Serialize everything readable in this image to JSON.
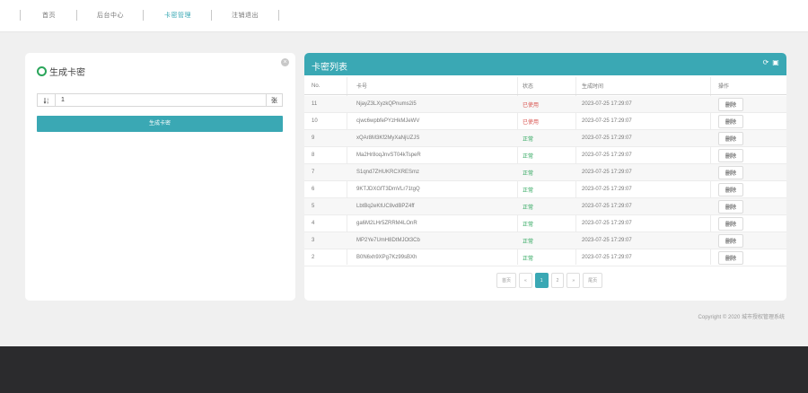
{
  "nav": {
    "items": [
      {
        "label": "首页",
        "active": false
      },
      {
        "label": "后台中心",
        "active": false
      },
      {
        "label": "卡密管理",
        "active": true
      },
      {
        "label": "注销退出",
        "active": false
      }
    ]
  },
  "generate": {
    "title": "生成卡密",
    "prefix_icon": "sort-number-icon",
    "quantity_value": "1",
    "suffix": "张",
    "button_label": "生成卡密",
    "close_icon": "close-icon"
  },
  "list": {
    "title": "卡密列表",
    "icons": [
      "refresh-icon",
      "fullscreen-icon"
    ],
    "columns": {
      "no": "No.",
      "card": "卡号",
      "status": "状态",
      "time": "生成时间",
      "action": "操作"
    },
    "rows": [
      {
        "no": "11",
        "card": "NjayZ3LXyzkQPnums2i5",
        "status": "已使用",
        "used": true,
        "time": "2023-07-25 17:29:07",
        "action": "删除"
      },
      {
        "no": "10",
        "card": "cjwc6wpbfePYzHkMJeWV",
        "status": "已使用",
        "used": true,
        "time": "2023-07-25 17:29:07",
        "action": "删除"
      },
      {
        "no": "9",
        "card": "xQAr8M3Kf2MyXaNjUZJS",
        "status": "正常",
        "used": false,
        "time": "2023-07-25 17:29:07",
        "action": "删除"
      },
      {
        "no": "8",
        "card": "Ma2Hr8oqJnvST04kTspeR",
        "status": "正常",
        "used": false,
        "time": "2023-07-25 17:29:07",
        "action": "删除"
      },
      {
        "no": "7",
        "card": "S1qnd7ZHUKRCXRESmz",
        "status": "正常",
        "used": false,
        "time": "2023-07-25 17:29:07",
        "action": "删除"
      },
      {
        "no": "6",
        "card": "9KTJDXGfT3DmVLr71tgQ",
        "status": "正常",
        "used": false,
        "time": "2023-07-25 17:29:07",
        "action": "删除"
      },
      {
        "no": "5",
        "card": "LbtBq2eKtUC8vdBPZ4ff",
        "status": "正常",
        "used": false,
        "time": "2023-07-25 17:29:07",
        "action": "删除"
      },
      {
        "no": "4",
        "card": "ga6M2LHr5ZRRM4LOnR",
        "status": "正常",
        "used": false,
        "time": "2023-07-25 17:29:07",
        "action": "删除"
      },
      {
        "no": "3",
        "card": "MP2Ye7UmH8DtMJOt3Cb",
        "status": "正常",
        "used": false,
        "time": "2023-07-25 17:29:07",
        "action": "删除"
      },
      {
        "no": "2",
        "card": "B0N6xh9XPg7Kz99sBXh",
        "status": "正常",
        "used": false,
        "time": "2023-07-25 17:29:07",
        "action": "删除"
      }
    ]
  },
  "pagination": {
    "first": "首页",
    "prev": "«",
    "pages": [
      "1",
      "2"
    ],
    "current": "1",
    "next": "»",
    "last": "尾页"
  },
  "footer": {
    "copyright": "Copyright © 2020 城市授权管理系统"
  },
  "colors": {
    "accent": "#3aa8b4",
    "used": "#d9534f",
    "unused": "#2aa55a",
    "footer_bg": "#2b2b2d"
  }
}
